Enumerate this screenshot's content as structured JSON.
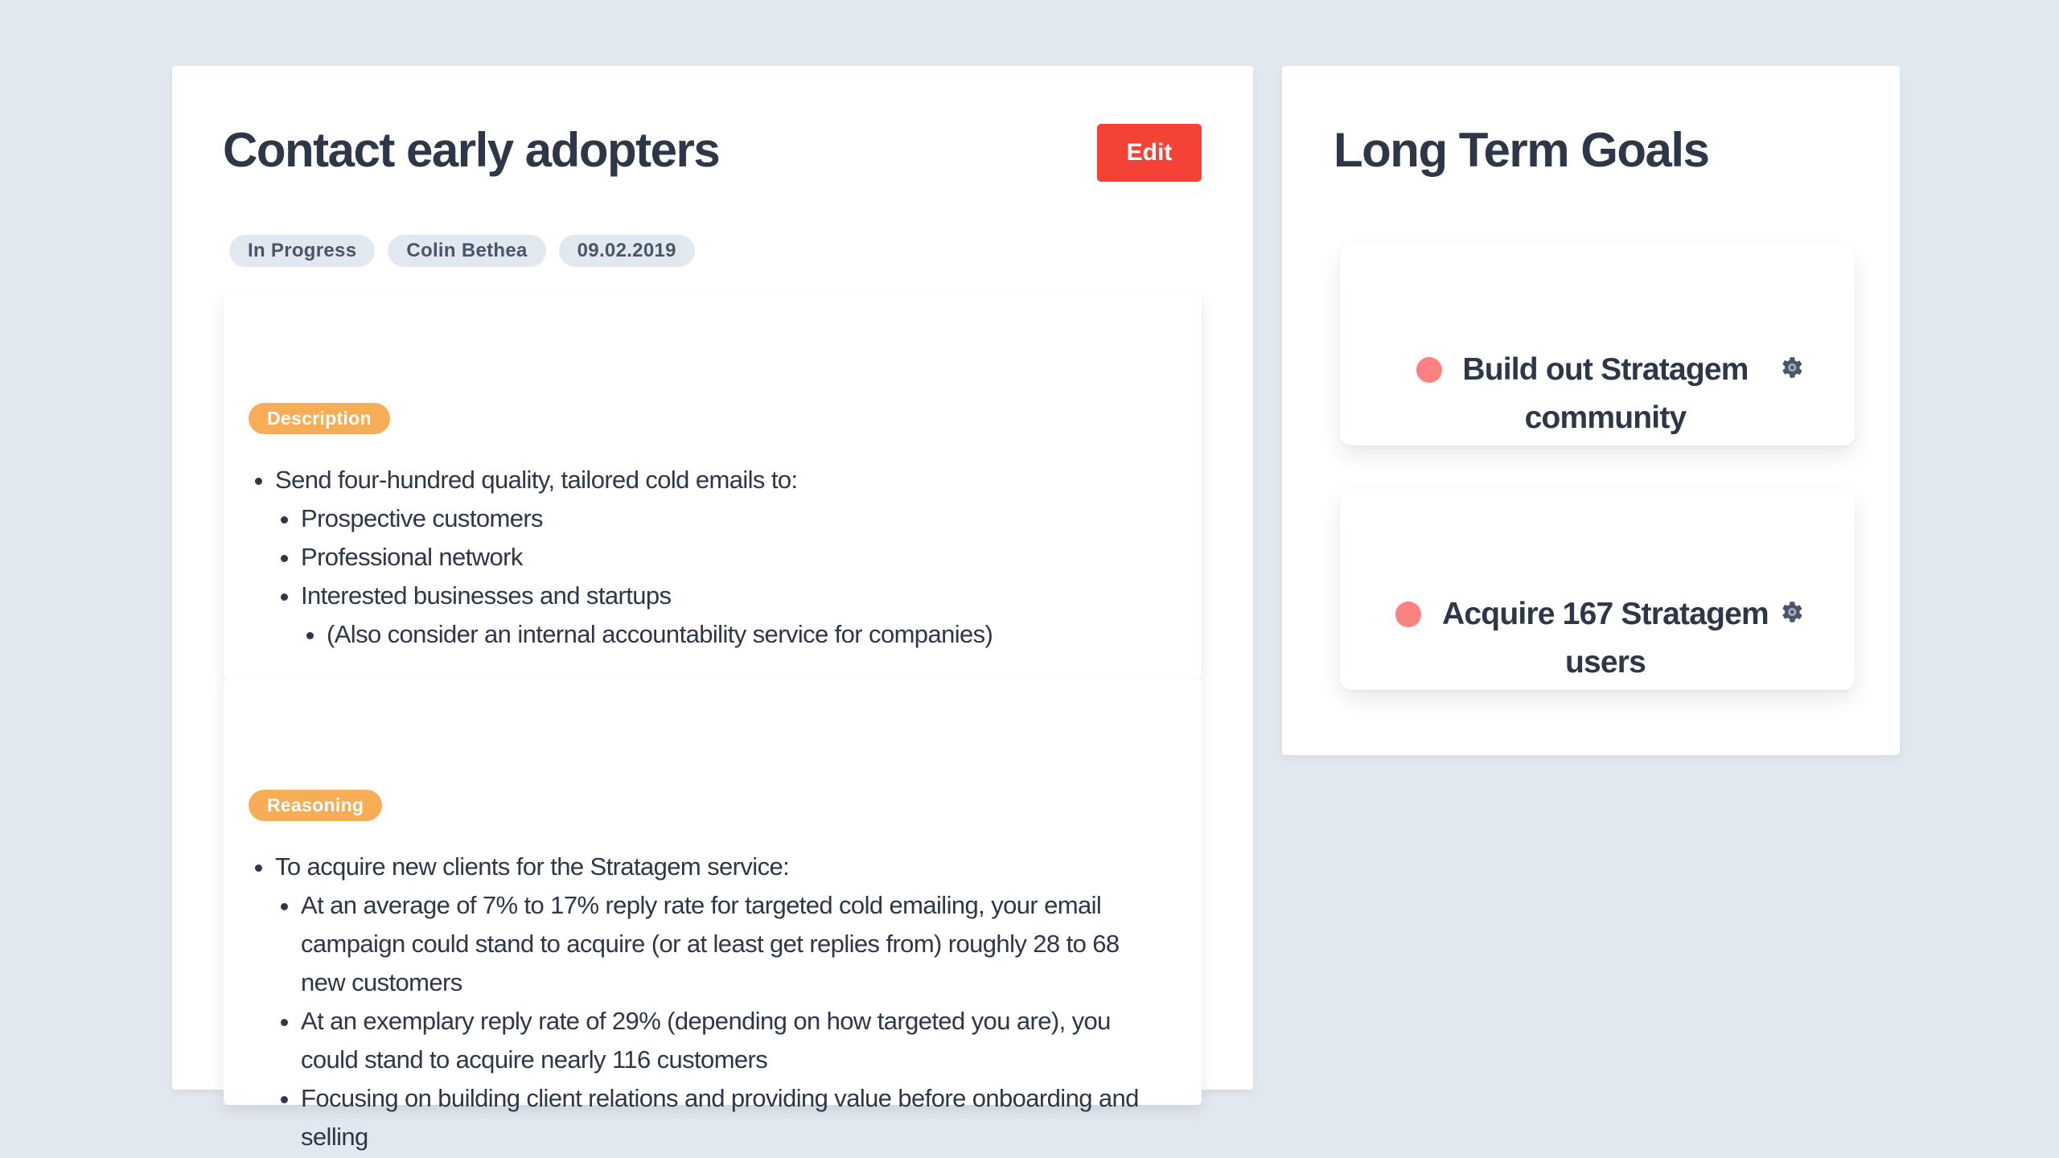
{
  "task": {
    "title": "Contact early adopters",
    "edit_label": "Edit",
    "tags": [
      "In Progress",
      "Colin Bethea",
      "09.02.2019"
    ],
    "description": {
      "label": "Description",
      "items": [
        "Send four-hundred quality, tailored cold emails to:",
        "Prospective customers",
        "Professional network",
        "Interested businesses and startups",
        "(Also consider an internal accountability service for companies)"
      ]
    },
    "reasoning": {
      "label": "Reasoning",
      "items": [
        "To acquire new clients for the Stratagem service:",
        "At an average of 7% to 17% reply rate for targeted cold emailing, your email campaign could stand to acquire (or at least get replies from) roughly 28 to 68 new customers",
        "At an exemplary reply rate of 29% (depending on how targeted you are), you could stand to acquire nearly 116 customers",
        "Focusing on building client relations and providing value before onboarding and selling"
      ]
    }
  },
  "goals": {
    "title": "Long Term Goals",
    "items": [
      {
        "label": "Build out Stratagem community",
        "icon": "gear-icon",
        "status_color": "#fc8181"
      },
      {
        "label": "Acquire 167 Stratagem users",
        "icon": "gear-icon",
        "status_color": "#fc8181"
      }
    ]
  },
  "colors": {
    "background": "#e2e8f0",
    "edit_button": "#f44336",
    "section_label": "#f6ad55",
    "tag": "#e2e8f0",
    "goal_dot": "#fc8181",
    "text": "#2d3748"
  }
}
